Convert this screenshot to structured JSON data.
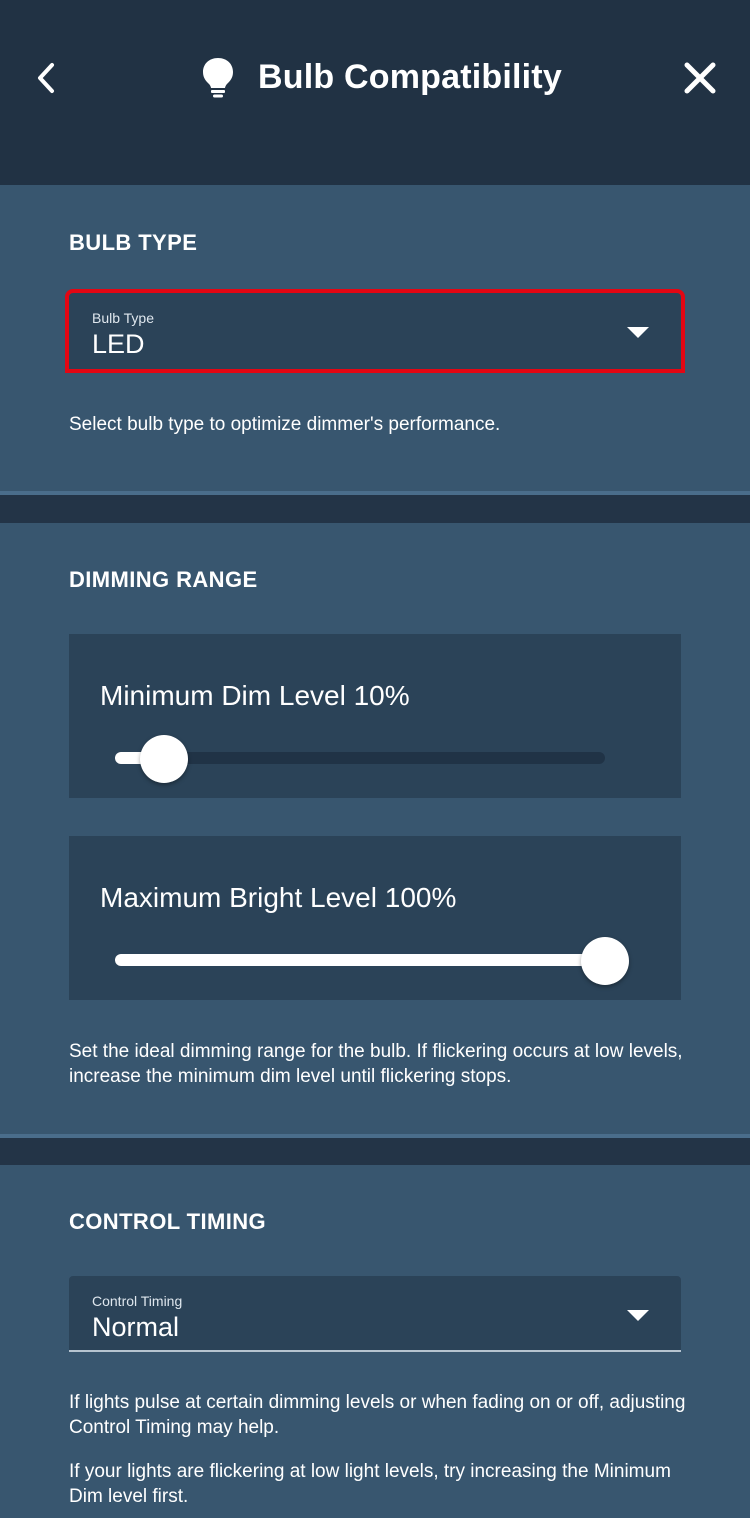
{
  "header": {
    "title": "Bulb Compatibility",
    "back_icon": "chevron-left-icon",
    "title_icon": "lightbulb-icon",
    "close_icon": "close-icon"
  },
  "bulb_type": {
    "section_title": "BULB TYPE",
    "select_label": "Bulb Type",
    "select_value": "LED",
    "helper": "Select bulb type to optimize dimmer's performance."
  },
  "dimming_range": {
    "section_title": "DIMMING RANGE",
    "min_title": "Minimum Dim Level 10%",
    "min_value_percent": 10,
    "max_title": "Maximum Bright Level 100%",
    "max_value_percent": 100,
    "helper": "Set the ideal dimming range for the bulb. If flickering occurs at low levels, increase the minimum dim level until flickering stops."
  },
  "control_timing": {
    "section_title": "CONTROL TIMING",
    "select_label": "Control Timing",
    "select_value": "Normal",
    "helper1": "If lights pulse at certain dimming levels or when fading on or off, adjusting Control Timing may help.",
    "helper2": "If your lights are flickering at low light levels, try increasing the Minimum Dim level first."
  },
  "colors": {
    "header_bg": "#213244",
    "section_bg": "#38566f",
    "control_bg": "#2b4358",
    "highlight": "#e30613"
  }
}
